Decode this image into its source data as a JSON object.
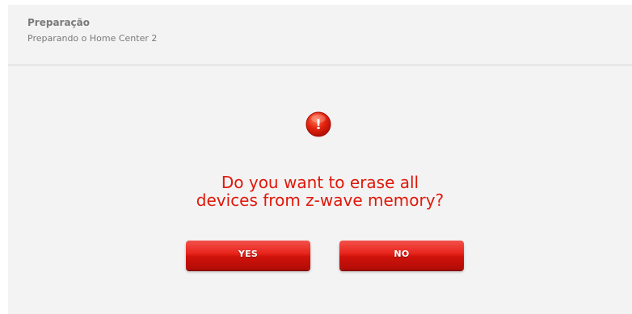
{
  "header": {
    "title": "Preparação",
    "subtitle": "Preparando o Home Center 2"
  },
  "dialog": {
    "icon": "alert-icon",
    "icon_glyph": "!",
    "message_line1": "Do you want to erase all",
    "message_line2": "devices from z-wave memory?",
    "yes_label": "YES",
    "no_label": "NO"
  },
  "colors": {
    "accent": "#e0180a",
    "button": "#d8170f",
    "panel_bg": "#f3f3f3"
  }
}
